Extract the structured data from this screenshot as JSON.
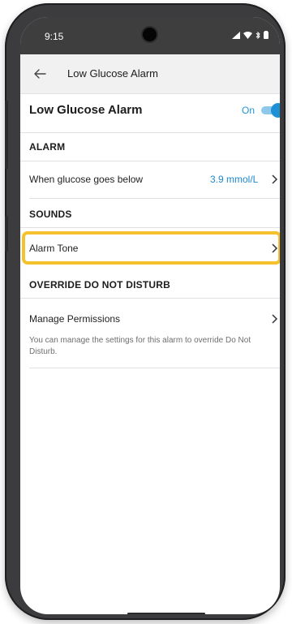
{
  "status_bar": {
    "time": "9:15",
    "icons": [
      "signal-icon",
      "wifi-icon",
      "bluetooth-icon",
      "battery-icon"
    ]
  },
  "app_bar": {
    "title": "Low Glucose Alarm",
    "back_icon": "arrow-left-icon"
  },
  "alarm_toggle": {
    "title": "Low Glucose Alarm",
    "state_label": "On",
    "enabled": true
  },
  "sections": {
    "alarm": {
      "header": "ALARM",
      "threshold_label": "When glucose goes below",
      "threshold_value": "3.9 mmol/L"
    },
    "sounds": {
      "header": "SOUNDS",
      "alarm_tone_label": "Alarm Tone"
    },
    "override": {
      "header": "OVERRIDE DO NOT DISTURB",
      "manage_label": "Manage Permissions",
      "helper_text": "You can manage the settings for this alarm to override Do Not Disturb."
    }
  },
  "colors": {
    "accent": "#1f8fd6",
    "highlight": "#f5c12d",
    "status_bar": "#3e3e3e",
    "app_bar": "#f1f1f1"
  }
}
